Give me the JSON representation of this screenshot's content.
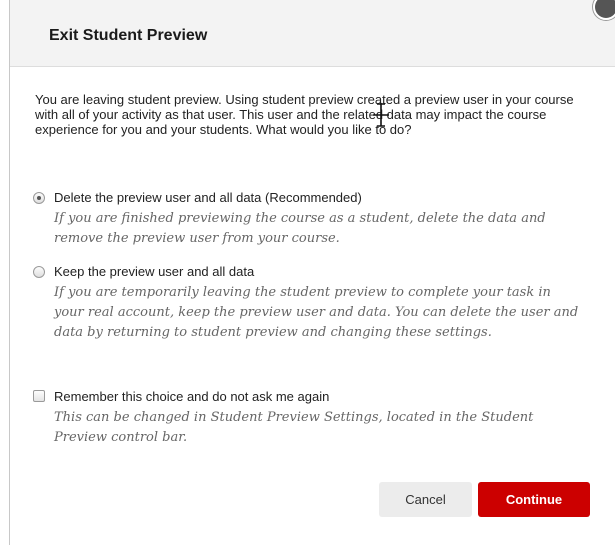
{
  "dialog": {
    "title": "Exit Student Preview",
    "close_icon": "close-icon",
    "intro": "You are leaving student preview. Using student preview created a preview user in your course with all of your activity as that user. This user and the related data may impact the course experience for you and your students. What would you like to do?"
  },
  "options": [
    {
      "type": "radio",
      "checked": true,
      "label": "Delete the preview user and all data (Recommended)",
      "description": "If you are finished previewing the course as a student, delete the data and remove the preview user from your course."
    },
    {
      "type": "radio",
      "checked": false,
      "label": "Keep the preview user and all data",
      "description": "If you are temporarily leaving the student preview to complete your task in your real account, keep the preview user and data. You can delete the user and data by returning to student preview and changing these settings."
    },
    {
      "type": "checkbox",
      "checked": false,
      "label": "Remember this choice and do not ask me again",
      "description": "This can be changed in Student Preview Settings, located in the Student Preview control bar."
    }
  ],
  "buttons": {
    "cancel": "Cancel",
    "continue": "Continue"
  },
  "colors": {
    "accent": "#cc0000",
    "header_bg": "#f3f3f3",
    "description_text": "#666666"
  }
}
